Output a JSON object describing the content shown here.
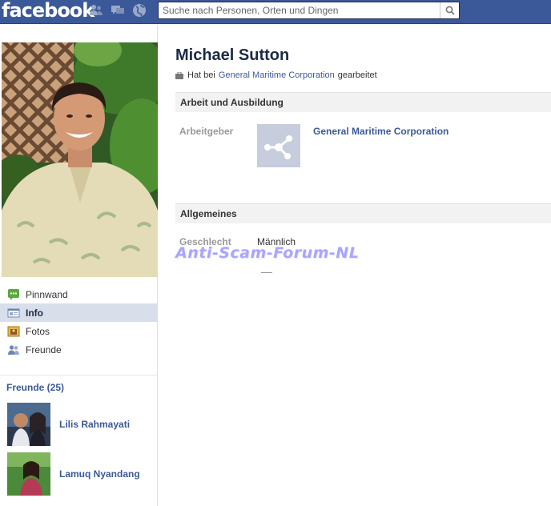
{
  "topbar": {
    "logo": "facebook",
    "search": {
      "placeholder": "Suche nach Personen, Orten und Dingen"
    },
    "jewels": [
      "friends-icon",
      "messages-icon",
      "notifications-globe-icon"
    ],
    "search_button_icon": "magnifier-icon"
  },
  "sidebar": {
    "nav": [
      {
        "label": "Pinnwand",
        "icon": "wall-icon"
      },
      {
        "label": "Info",
        "icon": "info-icon",
        "active": true
      },
      {
        "label": "Fotos",
        "icon": "photos-icon"
      },
      {
        "label": "Freunde",
        "icon": "friends-icon"
      }
    ],
    "friends_title": "Freunde (25)",
    "friends": [
      {
        "name": "Lilis Rahmayati"
      },
      {
        "name": "Lamuq Nyandang"
      }
    ]
  },
  "profile": {
    "name": "Michael Sutton",
    "subline": {
      "prefix": "Hat bei",
      "company": "General Maritime Corporation",
      "suffix": "gearbeitet",
      "icon": "briefcase-icon"
    }
  },
  "work": {
    "heading": "Arbeit und Ausbildung",
    "employer_label": "Arbeitgeber",
    "employer_name": "General Maritime Corporation",
    "employer_icon": "organization-icon"
  },
  "general": {
    "heading": "Allgemeines",
    "gender_label": "Geschlecht",
    "gender_value": "Männlich"
  },
  "watermark": "Anti-Scam-Forum-NL",
  "colors": {
    "brand": "#3b5998",
    "nav_active": "#d8dfea",
    "section_bg": "#f2f2f2",
    "watermark": "#a9a6ff"
  }
}
